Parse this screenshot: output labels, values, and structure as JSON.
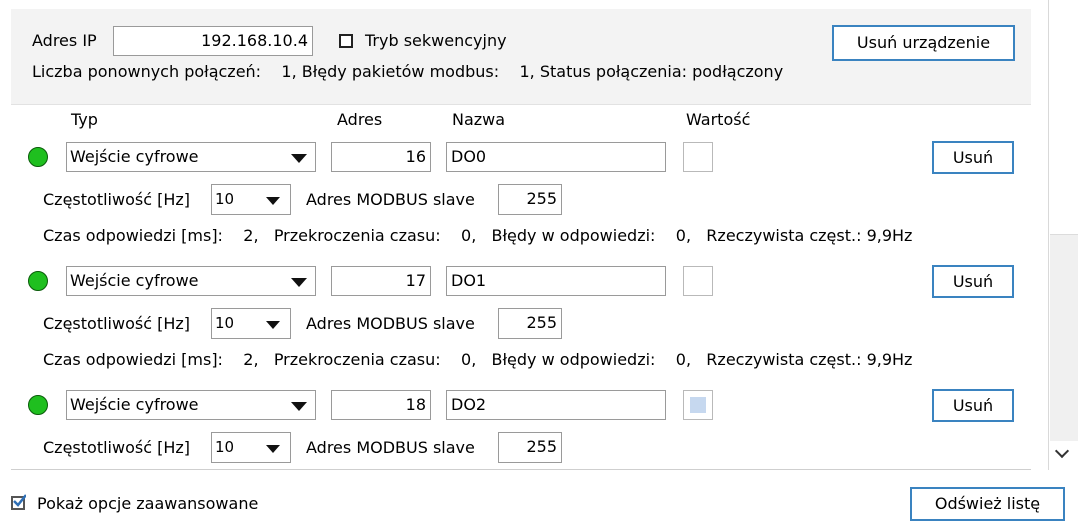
{
  "device": {
    "ip_label": "Adres IP",
    "ip_value": "192.168.10.4",
    "sequential_label": "Tryb sekwencyjny",
    "sequential_checked": false,
    "remove_device_label": "Usuń urządzenie",
    "status_line": "Liczba ponownych połączeń:    1, Błędy pakietów modbus:    1, Status połączenia: podłączony"
  },
  "columns": {
    "type": "Typ",
    "address": "Adres",
    "name": "Nazwa",
    "value": "Wartość"
  },
  "labels": {
    "frequency": "Częstotliwość [Hz]",
    "modbus_slave": "Adres MODBUS slave",
    "remove": "Usuń"
  },
  "channels": [
    {
      "type": "Wejście cyfrowe",
      "address": "16",
      "name": "DO0",
      "frequency": "10",
      "modbus_slave": "255",
      "value_on": false,
      "stats": "Czas odpowiedzi [ms]:    2,   Przekroczenia czasu:    0,   Błędy w odpowiedzi:    0,   Rzeczywista częst.: 9,9Hz"
    },
    {
      "type": "Wejście cyfrowe",
      "address": "17",
      "name": "DO1",
      "frequency": "10",
      "modbus_slave": "255",
      "value_on": false,
      "stats": "Czas odpowiedzi [ms]:    2,   Przekroczenia czasu:    0,   Błędy w odpowiedzi:    0,   Rzeczywista częst.: 9,9Hz"
    },
    {
      "type": "Wejście cyfrowe",
      "address": "18",
      "name": "DO2",
      "frequency": "10",
      "modbus_slave": "255",
      "value_on": true,
      "stats": ""
    }
  ],
  "footer": {
    "advanced_label": "Pokaż opcje zaawansowane",
    "advanced_checked": true,
    "refresh_label": "Odśwież listę"
  },
  "colors": {
    "led_green": "#1fbf1f",
    "button_border": "#3a83c0"
  }
}
